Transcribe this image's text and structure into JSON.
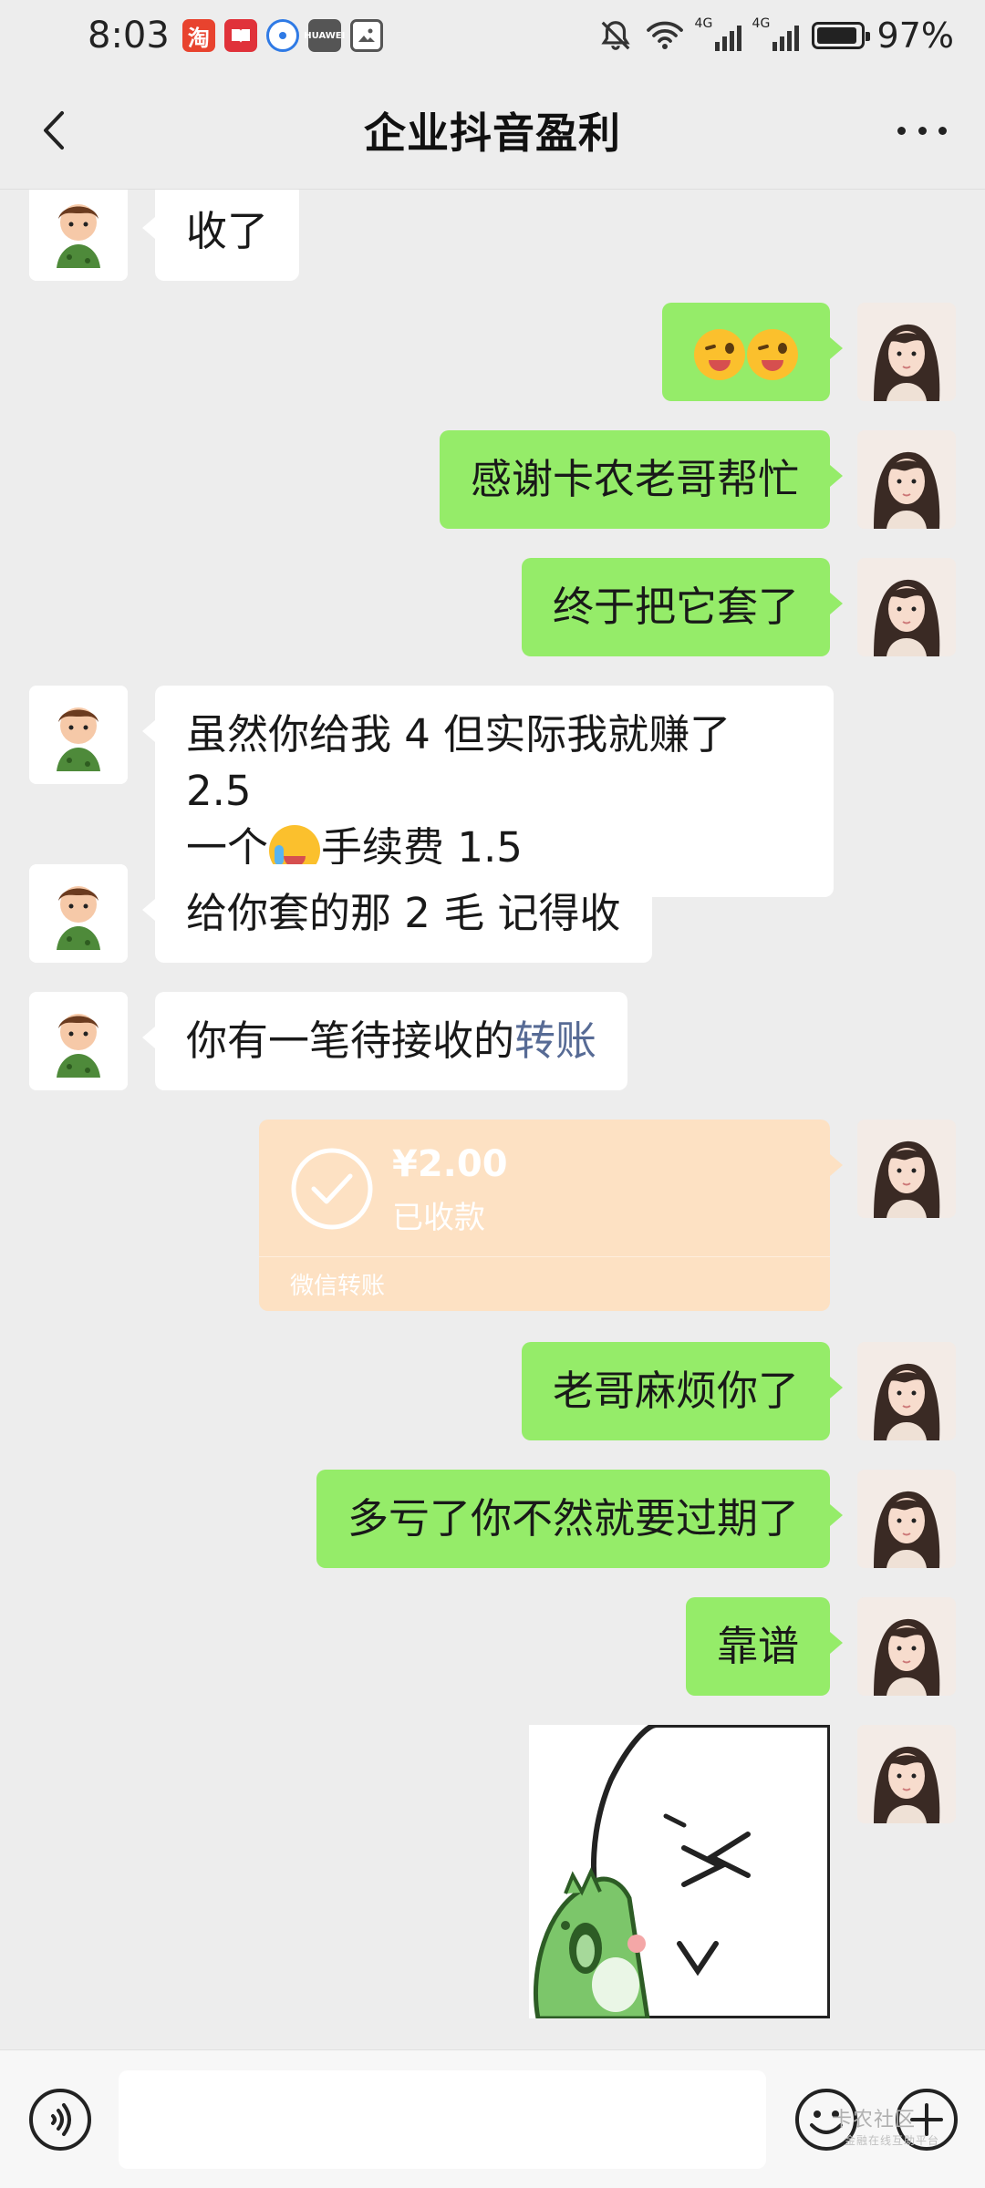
{
  "status_bar": {
    "time": "8:03",
    "notif_taobao": "淘",
    "notif_huawei": "HUAWEI",
    "signal1": "4G",
    "signal2": "4G",
    "battery": "97%"
  },
  "header": {
    "title": "企业抖音盈利"
  },
  "messages": {
    "m1": "收了",
    "m3": "感谢卡农老哥帮忙",
    "m4": "终于把它套了",
    "m5_line1": "虽然你给我 4 但实际我就赚了 2.5",
    "m5_line2a": "一个",
    "m5_line2b": "手续费 1.5",
    "m6": "给你套的那 2 毛 记得收",
    "m7a": "你有一笔待接收的",
    "m7b": "转账",
    "m9": "老哥麻烦你了",
    "m10": "多亏了你不然就要过期了",
    "m11": "靠谱"
  },
  "transfer": {
    "amount": "¥2.00",
    "status": "已收款",
    "source": "微信转账"
  },
  "watermark": {
    "main": "卡农社区",
    "sub": "金融在线互助平台"
  },
  "colors": {
    "accent_green": "#95ec69",
    "transfer_bg": "#fde1c3",
    "link": "#576b95",
    "background": "#ededed"
  }
}
